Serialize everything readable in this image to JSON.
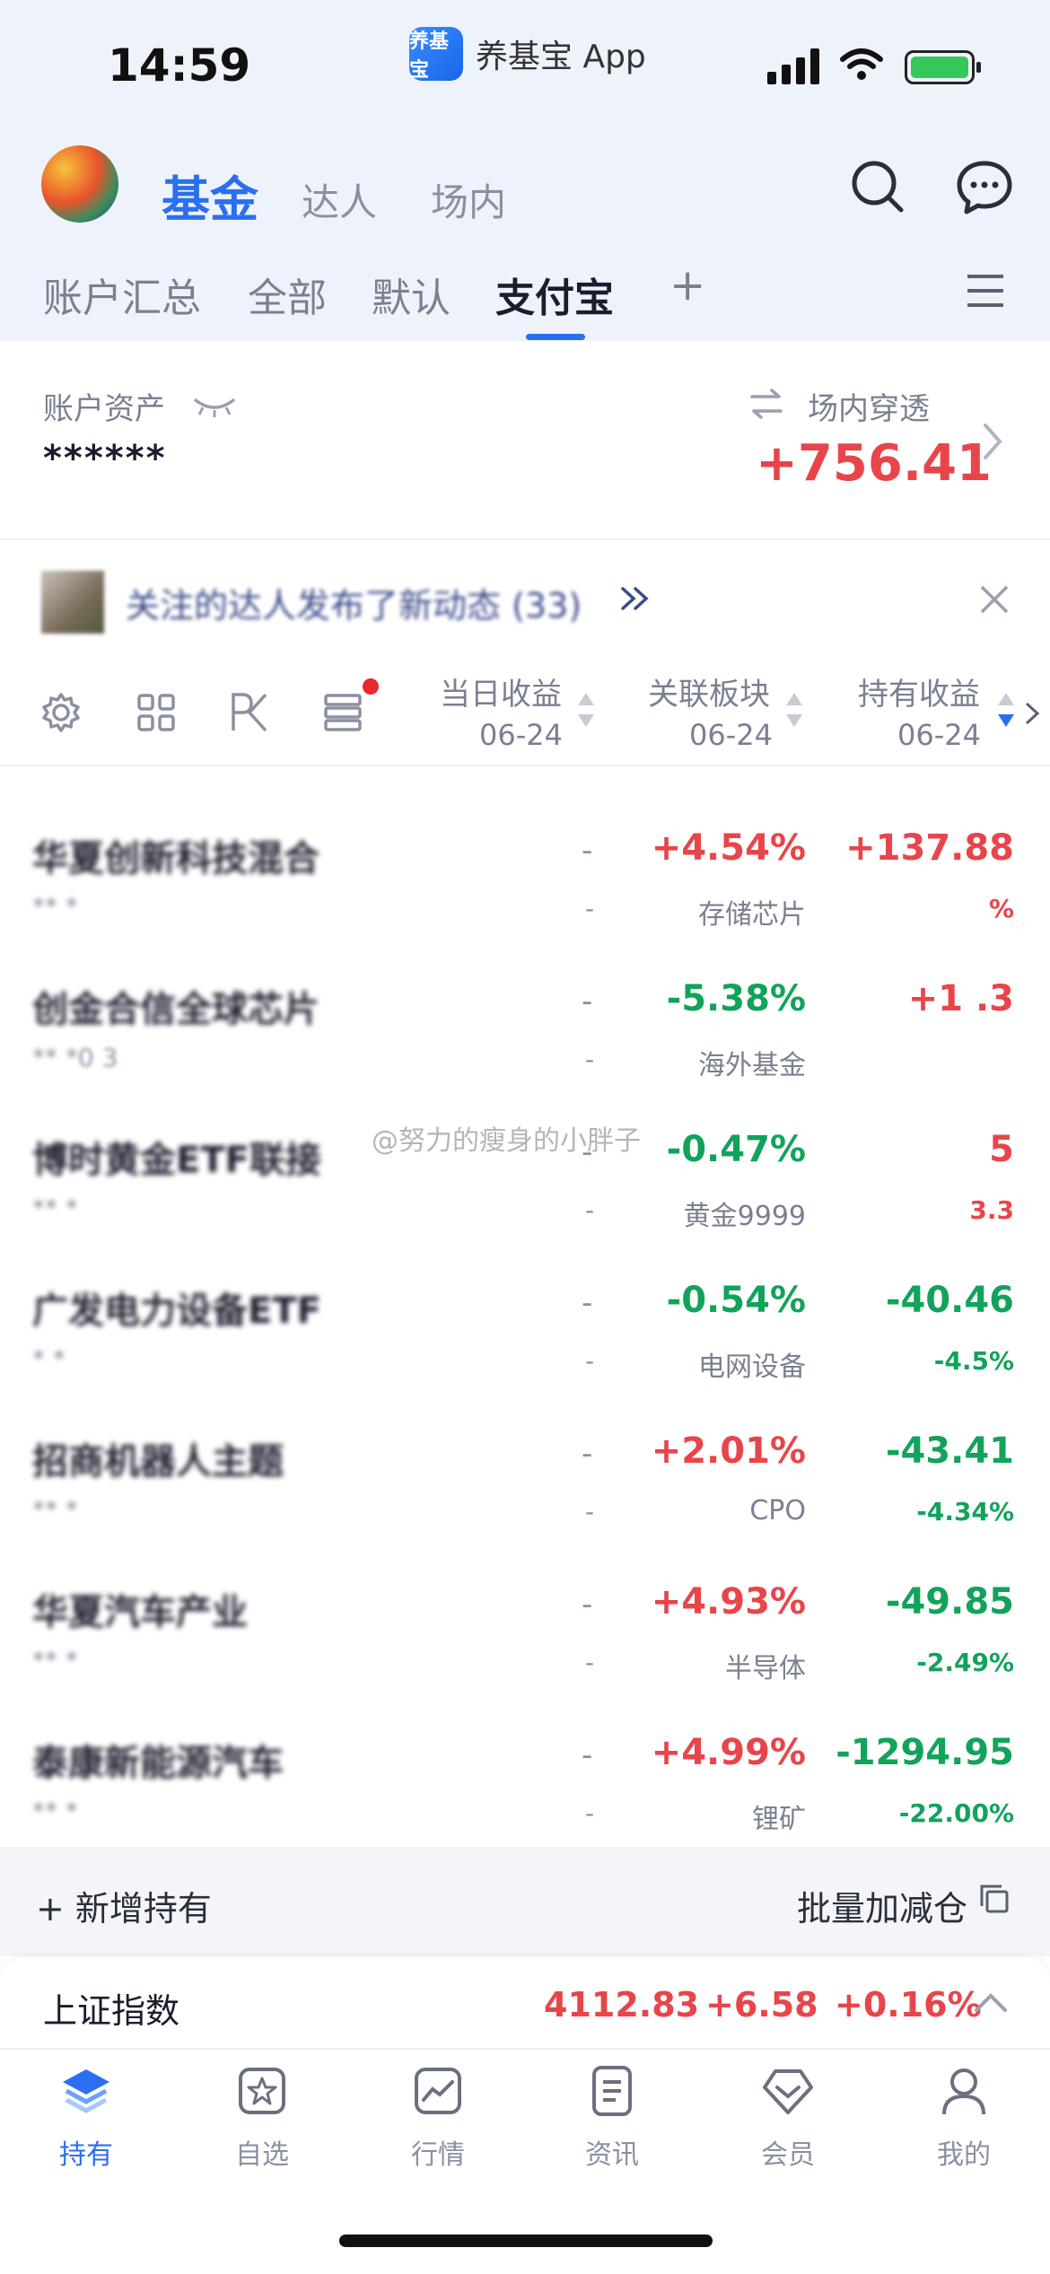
{
  "status_bar": {
    "time": "14:59",
    "app_name": "养基宝 App",
    "app_icon_text": "养基宝"
  },
  "header": {
    "tabs": [
      "基金",
      "达人",
      "场内"
    ],
    "subtabs": [
      "账户汇总",
      "全部",
      "默认",
      "支付宝"
    ],
    "active_subtab": "支付宝",
    "add_symbol": "+"
  },
  "account": {
    "label": "账户资产",
    "value": "******",
    "penetration_label": "场内穿透",
    "penetration_value": "+756.41"
  },
  "notice": {
    "text": "关注的达人发布了新动态 (33)"
  },
  "columns": [
    {
      "name": "当日收益",
      "date": "06-24"
    },
    {
      "name": "关联板块",
      "date": "06-24"
    },
    {
      "name": "持有收益",
      "date": "06-24"
    }
  ],
  "rows": [
    {
      "name": "华夏创新科技混合",
      "code": "** *",
      "daily": "-",
      "daily_sub": "-",
      "sector_pct": "+4.54%",
      "sector": "存储芯片",
      "hold": "+137.88",
      "hold_pct": "%"
    },
    {
      "name": "创金合信全球芯片",
      "code": "** *0 3",
      "daily": "-",
      "daily_sub": "-",
      "sector_pct": "-5.38%",
      "sector": "海外基金",
      "hold": "+1 .3",
      "hold_pct": ""
    },
    {
      "name": "博时黄金ETF联接",
      "code": "** *",
      "daily": "-",
      "daily_sub": "-",
      "sector_pct": "-0.47%",
      "sector": "黄金9999",
      "hold": "5",
      "hold_pct": "3.3"
    },
    {
      "name": "广发电力设备ETF",
      "code": "* *",
      "daily": "-",
      "daily_sub": "-",
      "sector_pct": "-0.54%",
      "sector": "电网设备",
      "hold": "-40.46",
      "hold_pct": "-4.5%"
    },
    {
      "name": "招商机器人主题",
      "code": "** *",
      "daily": "-",
      "daily_sub": "-",
      "sector_pct": "+2.01%",
      "sector": "CPO",
      "hold": "-43.41",
      "hold_pct": "-4.34%"
    },
    {
      "name": "华夏汽车产业",
      "code": "** *",
      "daily": "-",
      "daily_sub": "-",
      "sector_pct": "+4.93%",
      "sector": "半导体",
      "hold": "-49.85",
      "hold_pct": "-2.49%"
    },
    {
      "name": "泰康新能源汽车",
      "code": "** *",
      "daily": "-",
      "daily_sub": "-",
      "sector_pct": "+4.99%",
      "sector": "锂矿",
      "hold": "-1294.95",
      "hold_pct": "-22.00%"
    }
  ],
  "footer": {
    "add_label": "+ 新增持有",
    "batch_label": "批量加减仓"
  },
  "index_bar": {
    "name": "上证指数",
    "value": "4112.83",
    "change": "+6.58",
    "change_pct": "+0.16%"
  },
  "nav": [
    {
      "label": "持有",
      "icon": "layers-icon",
      "active": true
    },
    {
      "label": "自选",
      "icon": "star-icon",
      "active": false
    },
    {
      "label": "行情",
      "icon": "chart-icon",
      "active": false
    },
    {
      "label": "资讯",
      "icon": "document-icon",
      "active": false
    },
    {
      "label": "会员",
      "icon": "diamond-icon",
      "active": false
    },
    {
      "label": "我的",
      "icon": "user-icon",
      "active": false
    }
  ],
  "watermark": "@努力的瘦身的小胖子",
  "colors": {
    "accent": "#2a6ff0",
    "up": "#e8454a",
    "down": "#12a35a"
  }
}
